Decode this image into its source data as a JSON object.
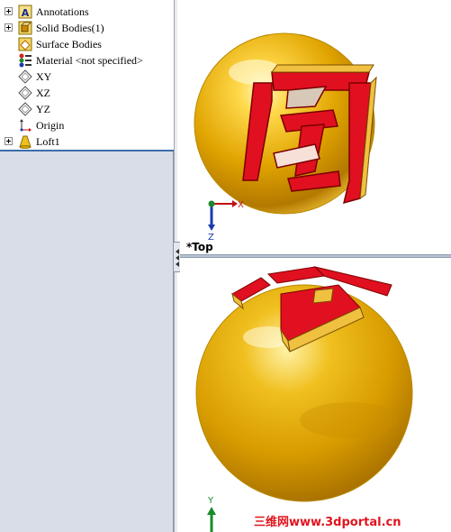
{
  "feature_tree": {
    "items": [
      {
        "label": "Annotations",
        "icon": "annotations-icon",
        "expandable": true
      },
      {
        "label": "Solid Bodies(1)",
        "icon": "solid-bodies-icon",
        "expandable": true
      },
      {
        "label": "Surface Bodies",
        "icon": "surface-bodies-icon",
        "expandable": false
      },
      {
        "label": "Material <not specified>",
        "icon": "material-icon",
        "expandable": false
      },
      {
        "label": "XY",
        "icon": "plane-icon",
        "expandable": false
      },
      {
        "label": "XZ",
        "icon": "plane-icon",
        "expandable": false
      },
      {
        "label": "YZ",
        "icon": "plane-icon",
        "expandable": false
      },
      {
        "label": "Origin",
        "icon": "origin-icon",
        "expandable": false
      },
      {
        "label": "Loft1",
        "icon": "loft-icon",
        "expandable": true
      }
    ]
  },
  "viewport_top": {
    "view_name": "*Top",
    "triad": {
      "x_label": "X",
      "z_label": "Z"
    }
  },
  "viewport_bottom": {
    "triad": {
      "y_label": "Y"
    }
  },
  "watermark": "三维网www.3dportal.cn",
  "colors": {
    "ball_gold": "#e6b000",
    "glyph_red": "#e01020",
    "tree_accent": "#3c6ea8"
  }
}
